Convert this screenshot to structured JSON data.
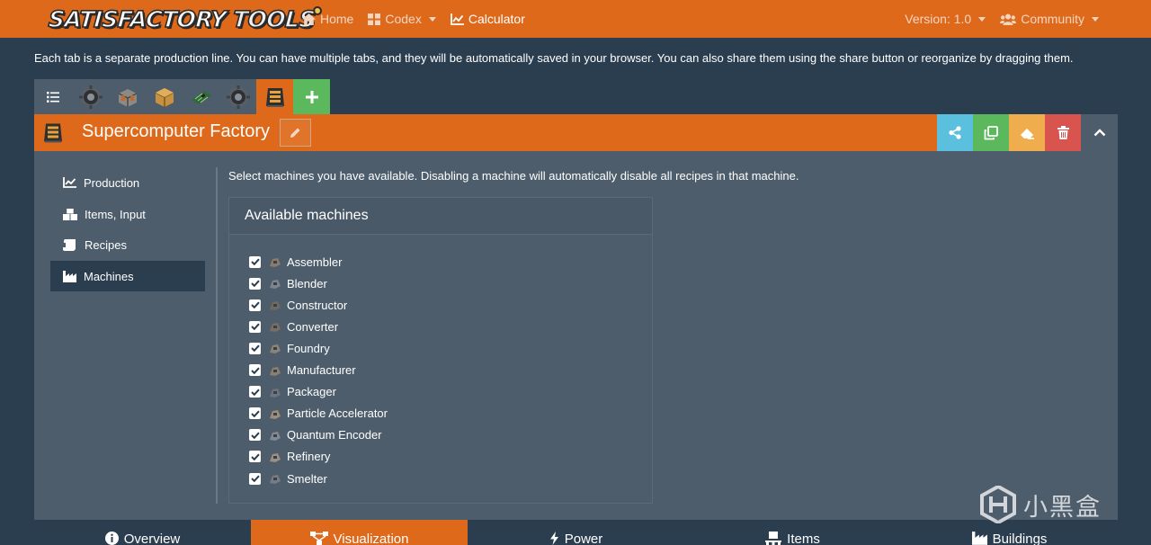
{
  "brand": {
    "logo_word_1": "SATISFACTORY",
    "logo_word_2": "TOOLS"
  },
  "nav": {
    "home": "Home",
    "codex": "Codex",
    "calculator": "Calculator",
    "version": "Version: 1.0",
    "community": "Community"
  },
  "info_text": "Each tab is a separate production line. You can have multiple tabs, and they will be automatically saved in your browser. You can also share them using the share button or reorganize by dragging them.",
  "factory": {
    "title": "Supercomputer Factory"
  },
  "sidebar": {
    "items": [
      {
        "label": "Production",
        "icon": "chart-line-icon"
      },
      {
        "label": "Items, Input",
        "icon": "boxes-icon"
      },
      {
        "label": "Recipes",
        "icon": "scroll-icon"
      },
      {
        "label": "Machines",
        "icon": "industry-icon",
        "active": true
      }
    ]
  },
  "machines": {
    "description": "Select machines you have available. Disabling a machine will automatically disable all recipes in that machine.",
    "card_title": "Available machines",
    "list": [
      {
        "name": "Assembler",
        "checked": true
      },
      {
        "name": "Blender",
        "checked": true
      },
      {
        "name": "Constructor",
        "checked": true
      },
      {
        "name": "Converter",
        "checked": true
      },
      {
        "name": "Foundry",
        "checked": true
      },
      {
        "name": "Manufacturer",
        "checked": true
      },
      {
        "name": "Packager",
        "checked": true
      },
      {
        "name": "Particle Accelerator",
        "checked": true
      },
      {
        "name": "Quantum Encoder",
        "checked": true
      },
      {
        "name": "Refinery",
        "checked": true
      },
      {
        "name": "Smelter",
        "checked": true
      }
    ]
  },
  "bottom_tabs": [
    {
      "label": "Overview",
      "icon": "info-circle-icon"
    },
    {
      "label": "Visualization",
      "icon": "project-diagram-icon",
      "active": true
    },
    {
      "label": "Power",
      "icon": "bolt-icon"
    },
    {
      "label": "Items",
      "icon": "pallet-icon"
    },
    {
      "label": "Buildings",
      "icon": "industry-icon"
    }
  ],
  "watermark": {
    "text": "小黑盒"
  },
  "colors": {
    "accent_orange": "#df691a",
    "background": "#2b3e50",
    "panel": "#4e5d6c",
    "success_green": "#5cb85c",
    "info_blue": "#5bc0de",
    "warning_yellow": "#f0ad4e",
    "danger_red": "#d9534f"
  }
}
